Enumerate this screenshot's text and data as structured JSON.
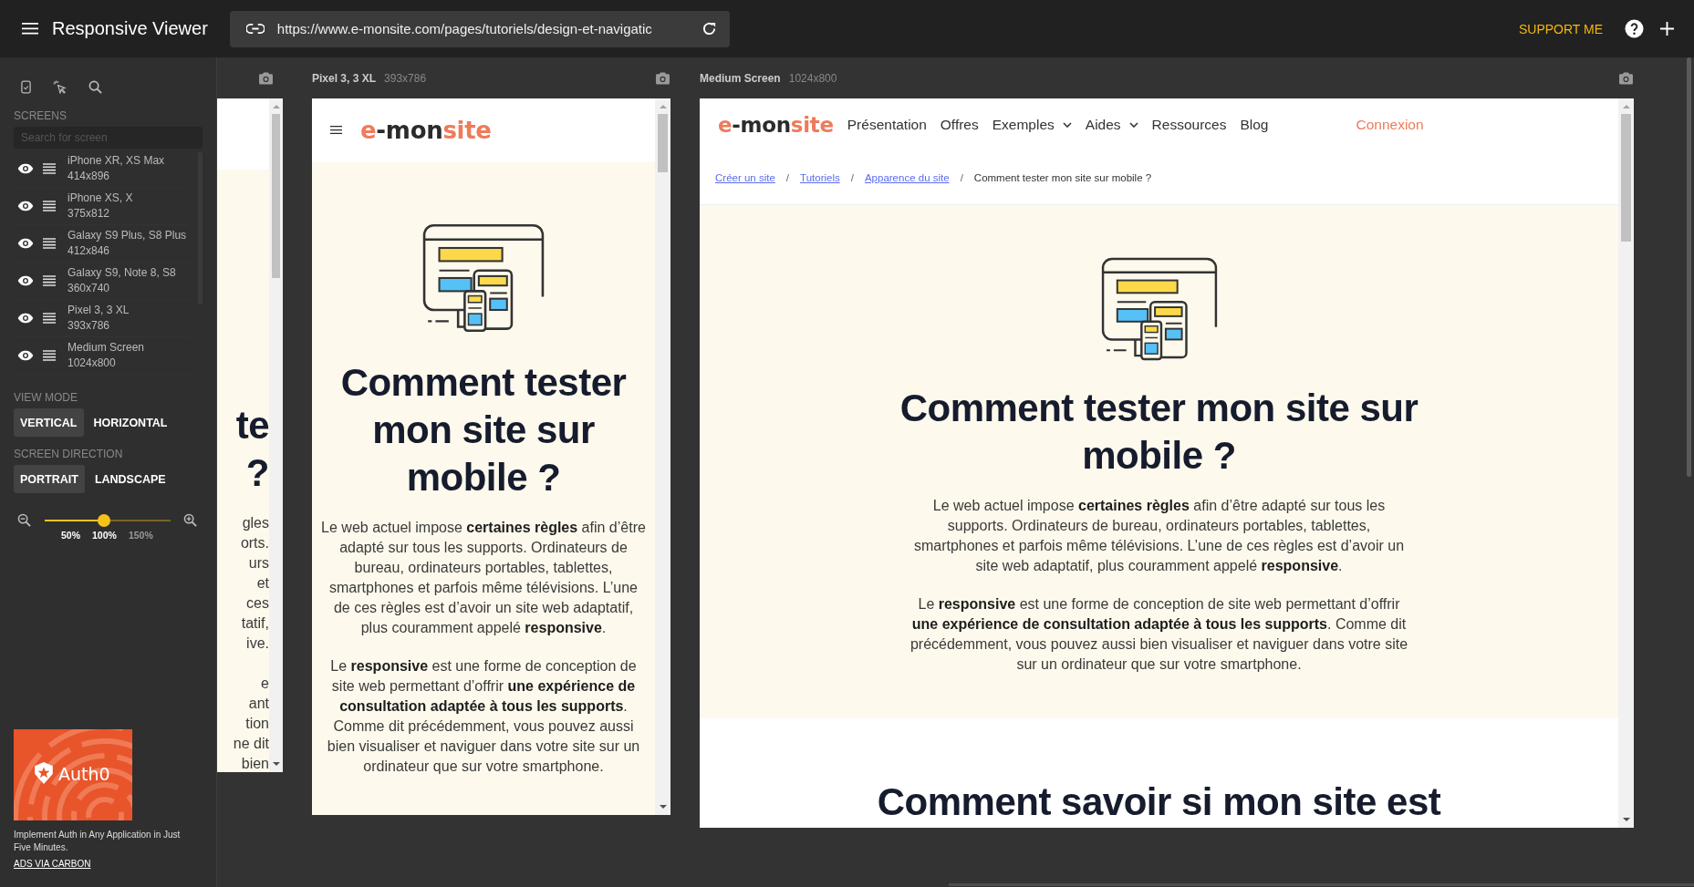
{
  "app": {
    "title": "Responsive Viewer",
    "url": "https://www.e-monsite.com/pages/tutoriels/design-et-navigatic",
    "support": "SUPPORT ME"
  },
  "sidebar": {
    "screens_label": "SCREENS",
    "search": {
      "placeholder": "Search for screen"
    },
    "screens": [
      {
        "name": "iPhone XR, XS Max",
        "size": "414x896"
      },
      {
        "name": "iPhone XS, X",
        "size": "375x812"
      },
      {
        "name": "Galaxy S9 Plus, S8 Plus",
        "size": "412x846"
      },
      {
        "name": "Galaxy S9, Note 8, S8",
        "size": "360x740"
      },
      {
        "name": "Pixel 3, 3 XL",
        "size": "393x786"
      },
      {
        "name": "Medium Screen",
        "size": "1024x800"
      }
    ],
    "view_mode": {
      "label": "VIEW MODE",
      "options": [
        {
          "label": "VERTICAL",
          "selected": true
        },
        {
          "label": "HORIZONTAL",
          "selected": false
        }
      ]
    },
    "screen_direction": {
      "label": "SCREEN DIRECTION",
      "options": [
        {
          "label": "PORTRAIT",
          "selected": true
        },
        {
          "label": "LANDSCAPE",
          "selected": false
        }
      ]
    },
    "zoom": {
      "level": 0.47,
      "marks": [
        {
          "label": "50%",
          "reached": true
        },
        {
          "label": "100%",
          "reached": true
        },
        {
          "label": "150%",
          "reached": false
        }
      ]
    },
    "ad": {
      "brand": "Auth0",
      "text": "Implement Auth in Any Application in Just Five Minutes.",
      "link": "ADS VIA CARBON"
    }
  },
  "frames": [
    {
      "kind": "partial",
      "heading_lines": [
        "te",
        "?"
      ],
      "paragraphs": [
        [
          "gles",
          "orts.",
          "urs",
          "et",
          "ces",
          "tatif,",
          "ive."
        ],
        [
          "e",
          "ant",
          "tion",
          "ne dit",
          "bien"
        ]
      ]
    },
    {
      "kind": "mobile",
      "name": "Pixel 3, 3 XL",
      "size": "393x786",
      "logo": [
        {
          "text": "e",
          "color": "#ee7b5b"
        },
        {
          "text": "-mon",
          "color": "#2b2b2b"
        },
        {
          "text": "site",
          "color": "#ee7b5b"
        }
      ],
      "heading": "Comment tester mon site sur mobile ?",
      "paragraphs": [
        "Le web actuel impose **certaines règles** afin d’être adapté sur tous les supports. Ordinateurs de bureau, ordinateurs portables, tablettes, smartphones et parfois même télévisions. L’une de ces règles est d’avoir un site web adaptatif, plus couramment appelé **responsive**.",
        "Le **responsive** est une forme de conception de site web permettant d’offrir **une expérience de consultation adaptée à tous les supports**. Comme dit précédemment, vous pouvez aussi bien visualiser et naviguer dans votre site sur un ordinateur que sur votre smartphone."
      ]
    },
    {
      "kind": "desktop",
      "name": "Medium Screen",
      "size": "1024x800",
      "logo": [
        {
          "text": "e",
          "color": "#ee7b5b"
        },
        {
          "text": "-mon",
          "color": "#2b2b2b"
        },
        {
          "text": "site",
          "color": "#ee7b5b"
        }
      ],
      "nav": [
        {
          "label": "Présentation",
          "kind": "menu",
          "dropdown": false
        },
        {
          "label": "Offres",
          "kind": "menu",
          "dropdown": false
        },
        {
          "label": "Exemples",
          "kind": "menu",
          "dropdown": true
        },
        {
          "label": "Aides",
          "kind": "menu",
          "dropdown": true
        },
        {
          "label": "Ressources",
          "kind": "menu",
          "dropdown": false
        },
        {
          "label": "Blog",
          "kind": "menu",
          "dropdown": false
        },
        {
          "label": "Connexion",
          "kind": "login",
          "dropdown": false
        }
      ],
      "breadcrumb": [
        {
          "text": "Créer un site",
          "kind": "link"
        },
        {
          "text": "/",
          "kind": "separator"
        },
        {
          "text": "Tutoriels",
          "kind": "link"
        },
        {
          "text": "/",
          "kind": "separator"
        },
        {
          "text": "Apparence du site",
          "kind": "link"
        },
        {
          "text": "/",
          "kind": "separator"
        },
        {
          "text": "Comment tester mon site sur mobile ?",
          "kind": "current"
        }
      ],
      "heading": "Comment tester mon site sur mobile ?",
      "paragraphs": [
        "Le web actuel impose **certaines règles** afin d’être adapté sur tous les supports. Ordinateurs de bureau, ordinateurs portables, tablettes, smartphones et parfois même télévisions. L’une de ces règles est d’avoir un site web adaptatif, plus couramment appelé **responsive**.",
        "Le **responsive** est une forme de conception de site web permettant d’offrir **une expérience de consultation adaptée à tous les supports**. Comme dit précédemment, vous pouvez aussi bien visualiser et naviguer dans votre site sur un ordinateur que sur votre smartphone."
      ],
      "next_heading": "Comment savoir si mon site est"
    }
  ]
}
